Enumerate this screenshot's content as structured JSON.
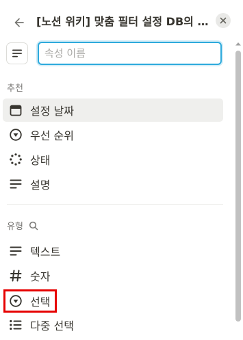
{
  "header": {
    "title": "[노션 위키] 맞춤 필터 설정 DB의 ...",
    "back_icon": "arrow-left-icon",
    "close_icon": "close-icon"
  },
  "search": {
    "placeholder": "속성 이름",
    "value": ""
  },
  "sections": {
    "recommended_label": "추천",
    "types_label": "유형"
  },
  "recommended_items": [
    {
      "label": "설정 날짜",
      "icon": "calendar-icon"
    },
    {
      "label": "우선 순위",
      "icon": "select-icon"
    },
    {
      "label": "상태",
      "icon": "status-icon"
    },
    {
      "label": "설명",
      "icon": "text-icon"
    }
  ],
  "type_items": [
    {
      "label": "텍스트",
      "icon": "text-icon"
    },
    {
      "label": "숫자",
      "icon": "number-icon"
    },
    {
      "label": "선택",
      "icon": "select-icon",
      "highlighted": true
    },
    {
      "label": "다중 선택",
      "icon": "multi-select-icon"
    }
  ],
  "colors": {
    "accent": "#2eaadc",
    "highlight_box": "#e60000",
    "hover_bg": "#efefed"
  }
}
